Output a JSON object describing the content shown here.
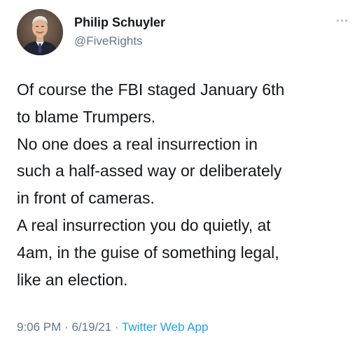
{
  "user": {
    "display_name": "Philip Schuyler",
    "handle": "@FiveRights",
    "avatar_icon": "profile-photo-man-in-suit"
  },
  "tweet": {
    "lines": [
      "Of course the FBI staged January 6th",
      "to blame Trumpers.",
      "No one does a real insurrection in",
      "such a half-assed way or deliberately",
      "in front of cameras.",
      "A real insurrection you do quietly, at",
      "4am, in the guise of something legal,",
      "like an election."
    ]
  },
  "meta": {
    "time": "9:06 PM",
    "separator": "·",
    "date": "6/19/21",
    "source": "Twitter Web App"
  },
  "colors": {
    "text": "#14171a",
    "secondary": "#657786",
    "link": "#1da1f2"
  }
}
